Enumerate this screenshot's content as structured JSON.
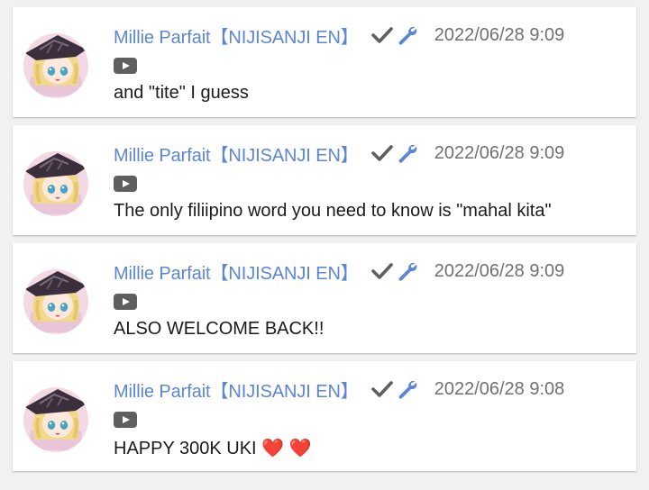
{
  "messages": [
    {
      "author": "Millie Parfait【NIJISANJI EN】",
      "timestamp": "2022/06/28 9:09",
      "text": "and \"tite\" I guess"
    },
    {
      "author": "Millie Parfait【NIJISANJI EN】",
      "timestamp": "2022/06/28 9:09",
      "text": "The only filiipino word you need to know is \"mahal kita\""
    },
    {
      "author": "Millie Parfait【NIJISANJI EN】",
      "timestamp": "2022/06/28 9:09",
      "text": "ALSO WELCOME BACK!!"
    },
    {
      "author": "Millie Parfait【NIJISANJI EN】",
      "timestamp": "2022/06/28 9:08",
      "text": "HAPPY 300K UKI ❤️ ❤️"
    }
  ],
  "icons": {
    "verified": "check-icon",
    "moderator": "wrench-icon",
    "source": "youtube-icon"
  },
  "colors": {
    "author_name": "#5b86d6",
    "verified_check": "#5f5f5f",
    "moderator_wrench": "#5b86d6",
    "timestamp": "#707070",
    "message_text": "#1a1a1a",
    "card_background": "#ffffff",
    "page_background": "#f1f1f1"
  }
}
